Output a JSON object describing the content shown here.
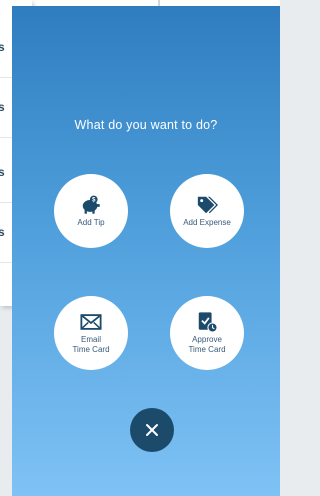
{
  "background_list": {
    "rows": [
      {
        "text": "s"
      },
      {
        "text": "s"
      },
      {
        "text": "s"
      },
      {
        "text": "s"
      }
    ]
  },
  "overlay": {
    "prompt": "What do you want to do?",
    "actions": {
      "add_tip": {
        "label": "Add Tip",
        "icon": "piggy-bank-icon"
      },
      "add_expense": {
        "label": "Add Expense",
        "icon": "tags-icon"
      },
      "email_time_card": {
        "label_line1": "Email",
        "label_line2": "Time Card",
        "icon": "envelope-icon"
      },
      "approve_time_card": {
        "label_line1": "Approve",
        "label_line2": "Time Card",
        "icon": "clipboard-check-icon"
      }
    },
    "close": {
      "icon": "close-icon"
    }
  },
  "colors": {
    "gradient_top": "#2f7dbf",
    "gradient_bottom": "#7fc2f5",
    "icon_navy": "#1b4a6b",
    "label_text": "#365a7a"
  }
}
